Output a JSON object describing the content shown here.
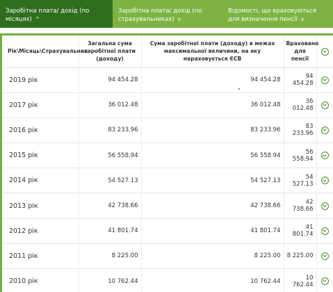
{
  "tabs": [
    {
      "label": "Заробітна плата/ дохід (по місяцях)",
      "chevron": "^",
      "active": true
    },
    {
      "label": "Заробітна плата/ дохід (по страхувальниках)",
      "chevron": "v",
      "active": false
    },
    {
      "label": "Відомості, що враховуються для визначення пенсії",
      "chevron": "v",
      "active": false
    }
  ],
  "colors": {
    "tab_bar": "#7cb342",
    "tab_active": "#2e6e1e",
    "accent": "#6db33f",
    "icon": "#4a8f2a"
  },
  "table": {
    "headers": {
      "year": "Рік\\Місяць\\Страхувальник",
      "total": "Загальна сума заробітної плати (доходу)",
      "capped": "Сума заробітної плати (доходу) в межах максимальної величини, на яку нараховується ЄСВ",
      "counted": "Враховано для пенсії",
      "expand_icon": "chevron-down-circle-icon"
    },
    "rows": [
      {
        "year": "2019 рік",
        "total": "94 454.28",
        "capped": "94 454.28",
        "counted": "94 454.28"
      },
      {
        "year": "2017 рік",
        "total": "36 012.48",
        "capped": "36 012.48",
        "counted": "36 012.48"
      },
      {
        "year": "2016 рік",
        "total": "83 233.96",
        "capped": "83 233.96",
        "counted": "83 233.96"
      },
      {
        "year": "2015 рік",
        "total": "56 558.94",
        "capped": "56 558.94",
        "counted": "56 558.94"
      },
      {
        "year": "2014 рік",
        "total": "54 527.13",
        "capped": "54 527.13",
        "counted": "54 527.13"
      },
      {
        "year": "2013 рік",
        "total": "42 738.66",
        "capped": "42 738.66",
        "counted": "42 738.66"
      },
      {
        "year": "2012 рік",
        "total": "41 801.74",
        "capped": "41 801.74",
        "counted": "41 801.74"
      },
      {
        "year": "2011 рік",
        "total": "8 225.00",
        "capped": "8 225.00",
        "counted": "8 225.00"
      },
      {
        "year": "2010 рік",
        "total": "10 762.44",
        "capped": "10 762.44",
        "counted": "10 762.44"
      }
    ]
  }
}
